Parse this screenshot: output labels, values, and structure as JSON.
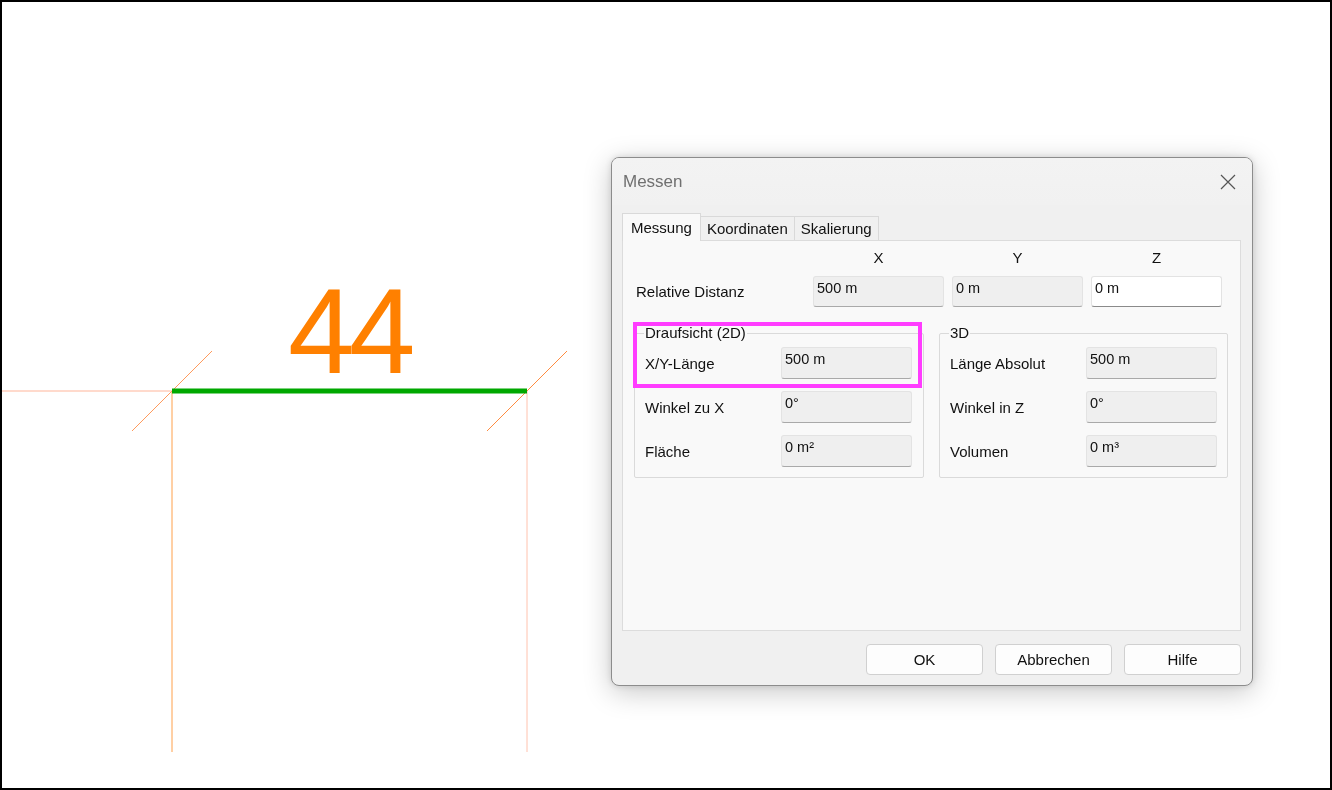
{
  "canvas": {
    "dimension_label": "44"
  },
  "dialog": {
    "title": "Messen",
    "tabs": [
      {
        "label": "Messung",
        "selected": true
      },
      {
        "label": "Koordinaten",
        "selected": false
      },
      {
        "label": "Skalierung",
        "selected": false
      }
    ],
    "column_headers": [
      "X",
      "Y",
      "Z"
    ],
    "relative_distance": {
      "label": "Relative Distanz",
      "fields": [
        {
          "value": "500 m",
          "editable": false
        },
        {
          "value": "0 m",
          "editable": false
        },
        {
          "value": "0 m",
          "editable": true
        }
      ]
    },
    "groups": [
      {
        "title": "Draufsicht (2D)",
        "rows": [
          {
            "label": "X/Y-Länge",
            "value": "500 m",
            "editable": false,
            "highlighted": true
          },
          {
            "label": "Winkel zu X",
            "value": "0°",
            "editable": false,
            "highlighted": false
          },
          {
            "label": "Fläche",
            "value": "0 m²",
            "editable": false,
            "highlighted": false
          }
        ]
      },
      {
        "title": "3D",
        "rows": [
          {
            "label": "Länge Absolut",
            "value": "500 m",
            "editable": false,
            "highlighted": false
          },
          {
            "label": "Winkel in Z",
            "value": "0°",
            "editable": false,
            "highlighted": false
          },
          {
            "label": "Volumen",
            "value": "0 m³",
            "editable": false,
            "highlighted": false
          }
        ]
      }
    ],
    "buttons": [
      "OK",
      "Abbrechen",
      "Hilfe"
    ]
  }
}
